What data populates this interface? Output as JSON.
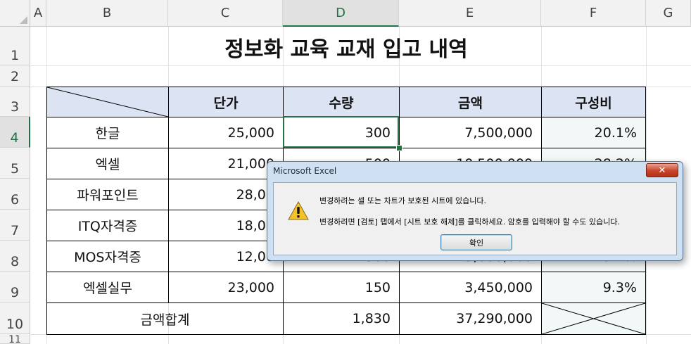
{
  "columns": [
    "A",
    "B",
    "C",
    "D",
    "E",
    "F",
    "G"
  ],
  "rows": [
    "1",
    "2",
    "3",
    "4",
    "5",
    "6",
    "7",
    "8",
    "9",
    "10",
    "11"
  ],
  "title": "정보화 교육 교재 입고 내역",
  "header": {
    "price": "단가",
    "qty": "수량",
    "amount": "금액",
    "ratio": "구성비"
  },
  "items": [
    {
      "name": "한글",
      "price": "25,000",
      "qty": "300",
      "amount": "7,500,000",
      "ratio": "20.1%"
    },
    {
      "name": "엑셀",
      "price": "21,000",
      "qty": "500",
      "amount": "10,500,000",
      "ratio": "28.2%"
    },
    {
      "name": "파워포인트",
      "price": "28,00",
      "qty": "",
      "amount": "",
      "ratio": ""
    },
    {
      "name": "ITQ자격증",
      "price": "18,00",
      "qty": "",
      "amount": "",
      "ratio": ""
    },
    {
      "name": "MOS자격증",
      "price": "12,00",
      "qty": "300",
      "amount": "3,600,000",
      "ratio": "9.7%"
    },
    {
      "name": "엑셀실무",
      "price": "23,000",
      "qty": "150",
      "amount": "3,450,000",
      "ratio": "9.3%"
    }
  ],
  "total": {
    "label": "금액합계",
    "qty": "1,830",
    "amount": "37,290,000"
  },
  "dialog": {
    "title": "Microsoft Excel",
    "close_label": "✕",
    "message_line1": "변경하려는 셀 또는 차트가 보호된 시트에 있습니다.",
    "message_line2": "변경하려면 [검토] 탭에서 [시트 보호 해제]를 클릭하세요. 암호를 입력해야 할 수도 있습니다.",
    "ok_label": "확인"
  },
  "colors": {
    "accent": "#217346",
    "header_fill": "#dce3f2"
  }
}
